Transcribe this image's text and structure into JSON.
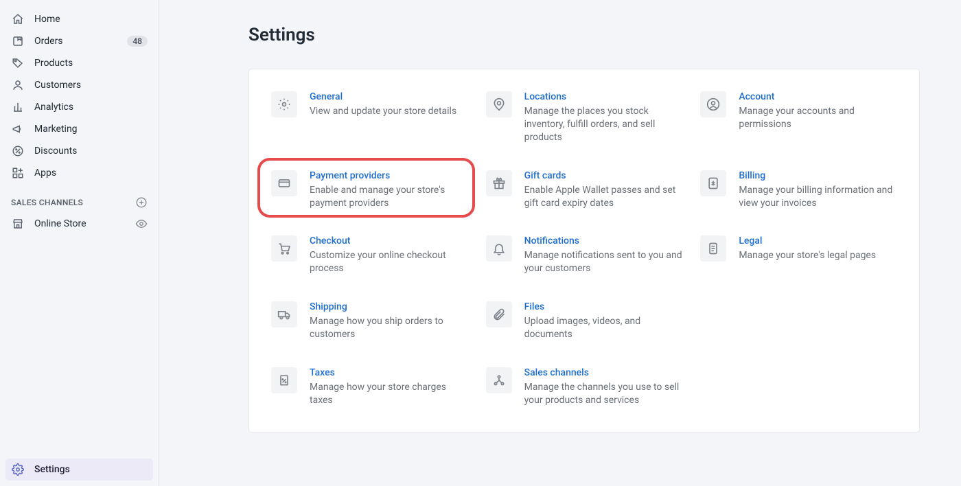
{
  "sidebar": {
    "items": [
      {
        "label": "Home"
      },
      {
        "label": "Orders",
        "badge": "48"
      },
      {
        "label": "Products"
      },
      {
        "label": "Customers"
      },
      {
        "label": "Analytics"
      },
      {
        "label": "Marketing"
      },
      {
        "label": "Discounts"
      },
      {
        "label": "Apps"
      }
    ],
    "channels_header": "SALES CHANNELS",
    "channels": [
      {
        "label": "Online Store"
      }
    ],
    "settings_label": "Settings"
  },
  "page": {
    "title": "Settings"
  },
  "settings": [
    {
      "title": "General",
      "desc": "View and update your store details"
    },
    {
      "title": "Locations",
      "desc": "Manage the places you stock inventory, fulfill orders, and sell products"
    },
    {
      "title": "Account",
      "desc": "Manage your accounts and permissions"
    },
    {
      "title": "Payment providers",
      "desc": "Enable and manage your store's payment providers"
    },
    {
      "title": "Gift cards",
      "desc": "Enable Apple Wallet passes and set gift card expiry dates"
    },
    {
      "title": "Billing",
      "desc": "Manage your billing information and view your invoices"
    },
    {
      "title": "Checkout",
      "desc": "Customize your online checkout process"
    },
    {
      "title": "Notifications",
      "desc": "Manage notifications sent to you and your customers"
    },
    {
      "title": "Legal",
      "desc": "Manage your store's legal pages"
    },
    {
      "title": "Shipping",
      "desc": "Manage how you ship orders to customers"
    },
    {
      "title": "Files",
      "desc": "Upload images, videos, and documents"
    },
    {
      "title": "Taxes",
      "desc": "Manage how your store charges taxes"
    },
    {
      "title": "Sales channels",
      "desc": "Manage the channels you use to sell your products and services"
    }
  ]
}
